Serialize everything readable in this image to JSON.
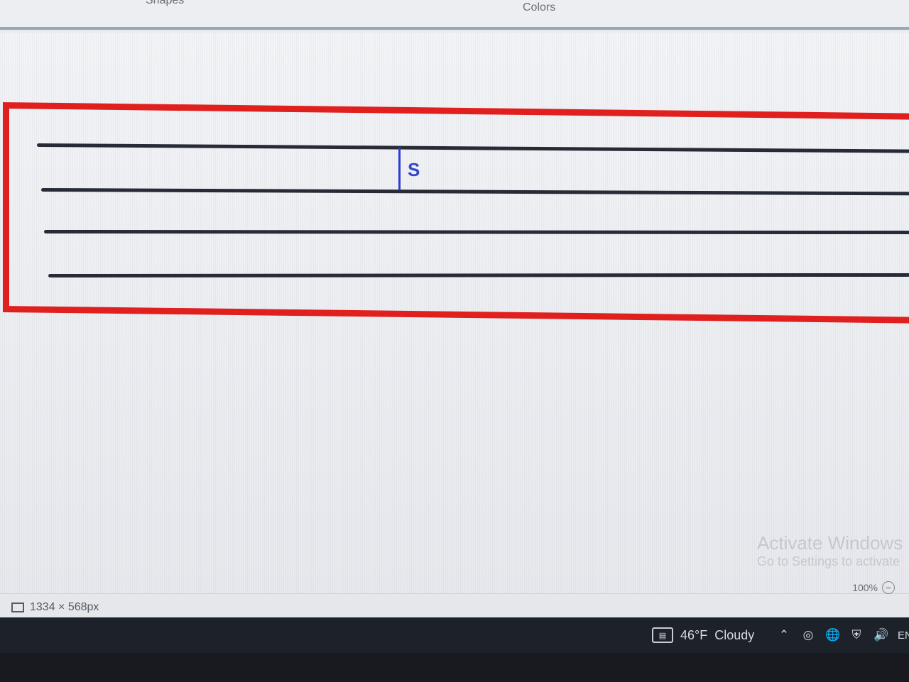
{
  "ribbon": {
    "shapes_label": "Shapes",
    "colors_label": "Colors"
  },
  "canvas": {
    "typed_text": "S"
  },
  "watermark": {
    "title": "Activate Windows",
    "subtitle": "Go to Settings to activate"
  },
  "status_bar": {
    "canvas_dimensions": "1334 × 568px",
    "zoom": "100%"
  },
  "taskbar": {
    "temperature": "46°F",
    "condition": "Cloudy",
    "language": "ENG"
  }
}
